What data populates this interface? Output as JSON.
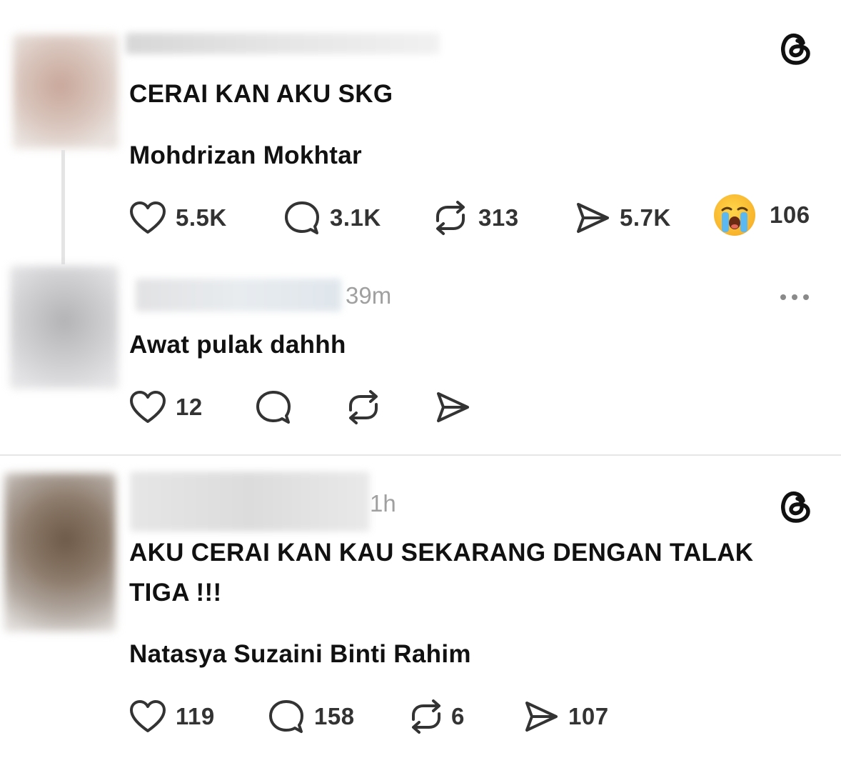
{
  "posts": [
    {
      "text": "CERAI KAN AKU SKG",
      "author_tag": "Mohdrizan Mokhtar",
      "stats": {
        "likes": "5.5K",
        "replies": "3.1K",
        "reposts": "313",
        "shares": "5.7K",
        "reaction": "106"
      },
      "reaction_icon": "loudly-crying-face-emoji",
      "badge_icon": "threads-logo-icon"
    },
    {
      "time": "39m",
      "text": "Awat pulak dahhh",
      "stats": {
        "likes": "12"
      },
      "menu_icon": "more-options-icon"
    },
    {
      "time": "1h",
      "text_line1": "AKU CERAI KAN KAU SEKARANG DENGAN TALAK",
      "text_line2": "TIGA !!!",
      "author_tag": "Natasya Suzaini Binti Rahim",
      "stats": {
        "likes": "119",
        "replies": "158",
        "reposts": "6",
        "shares": "107"
      },
      "badge_icon": "threads-logo-icon"
    }
  ],
  "colors": {
    "text": "#111111",
    "muted": "#a0a0a0",
    "icon": "#333333",
    "divider": "#e6e6e6"
  }
}
